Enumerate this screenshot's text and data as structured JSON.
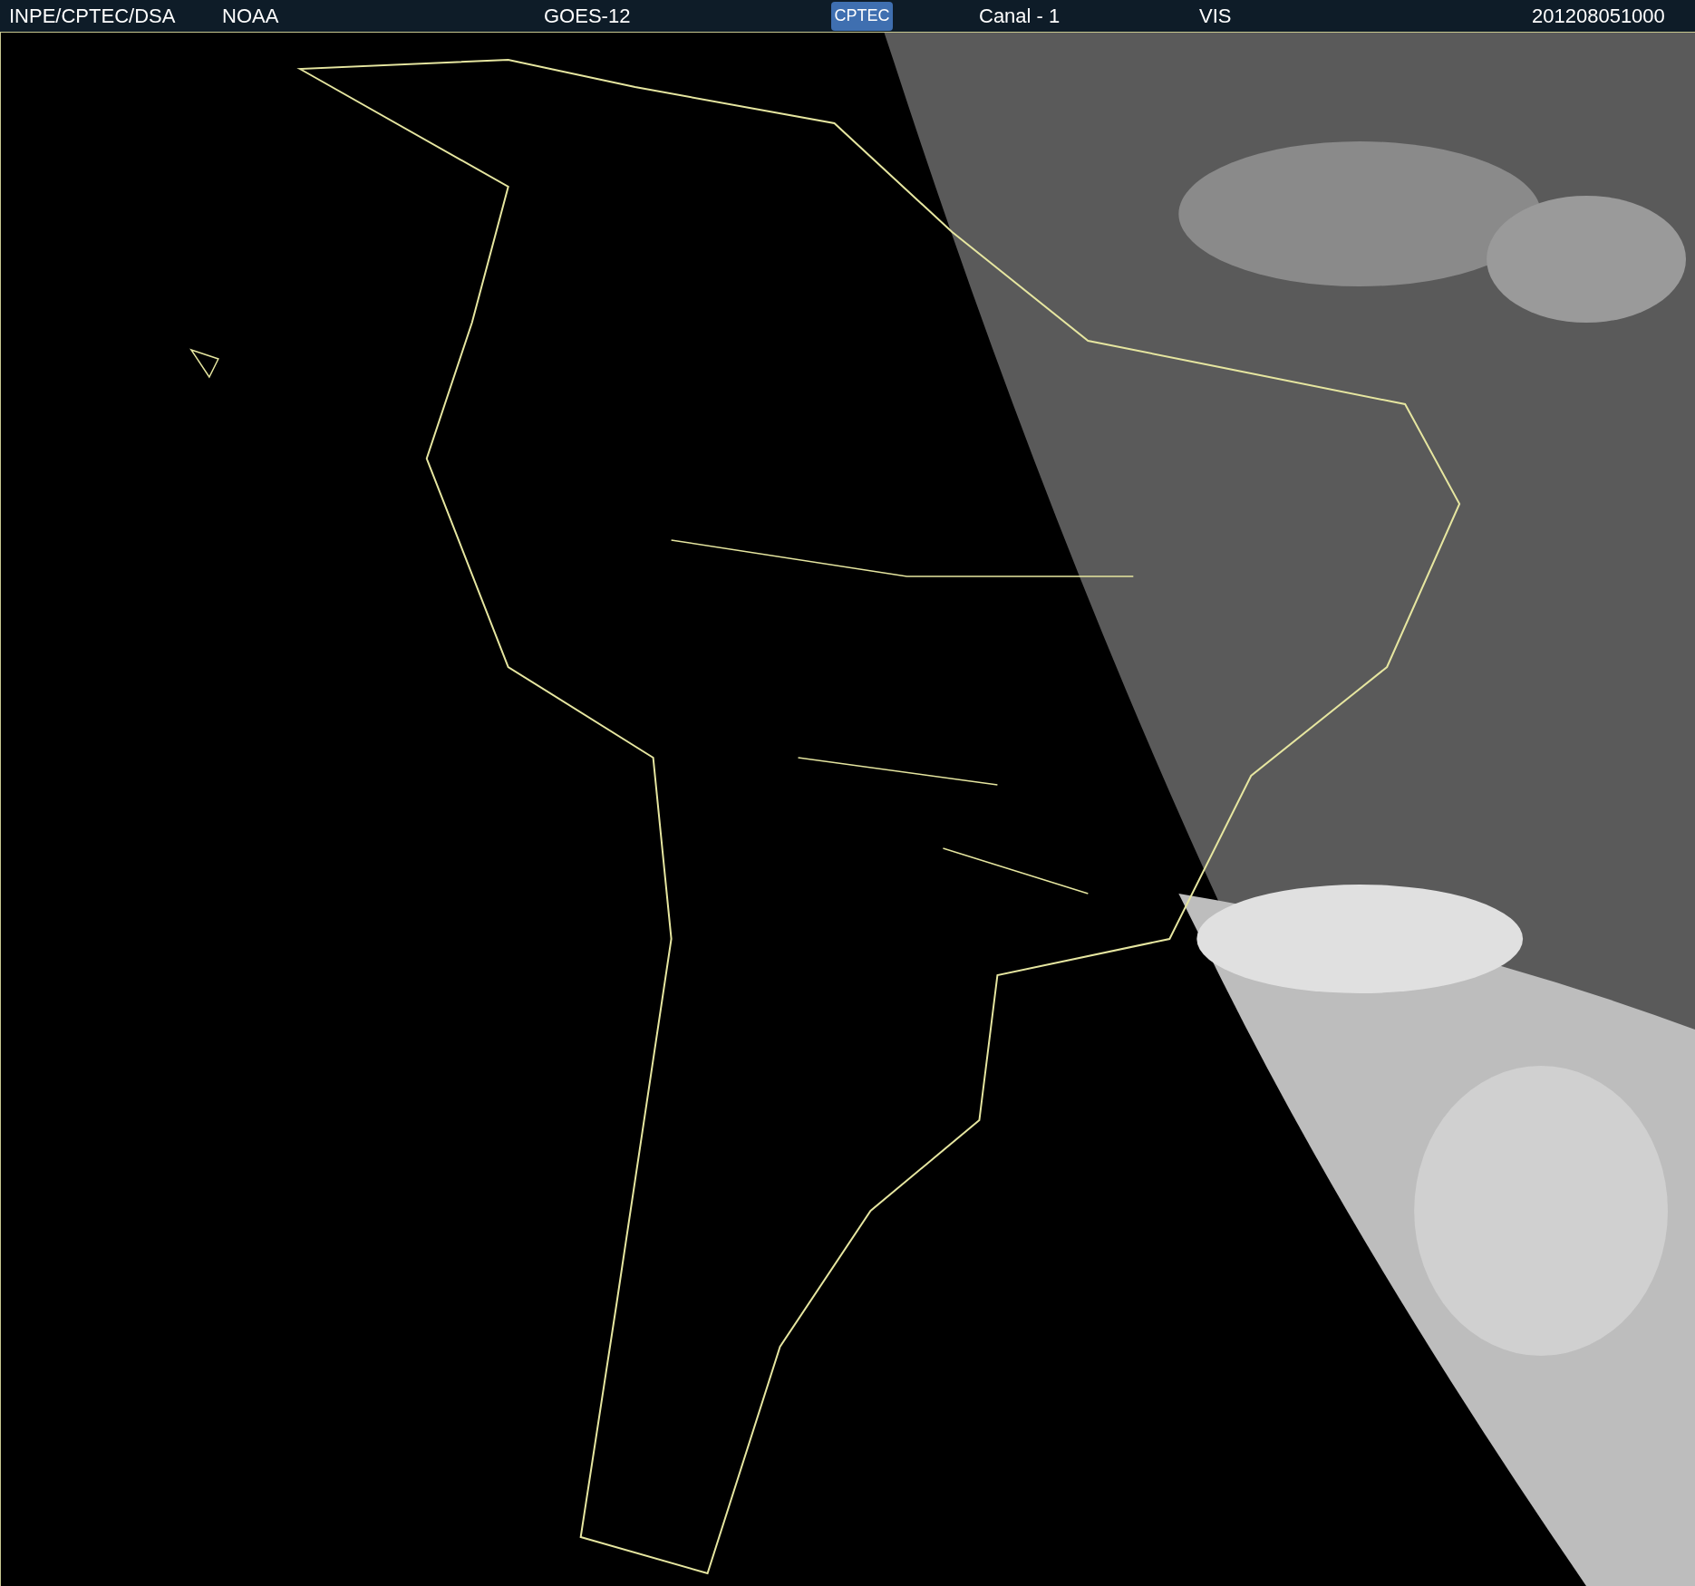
{
  "header": {
    "source": "INPE/CPTEC/DSA",
    "agency": "NOAA",
    "satellite": "GOES-12",
    "logo": "CPTEC",
    "channel": "Canal - 1",
    "band": "VIS",
    "timestamp": "201208051000"
  }
}
